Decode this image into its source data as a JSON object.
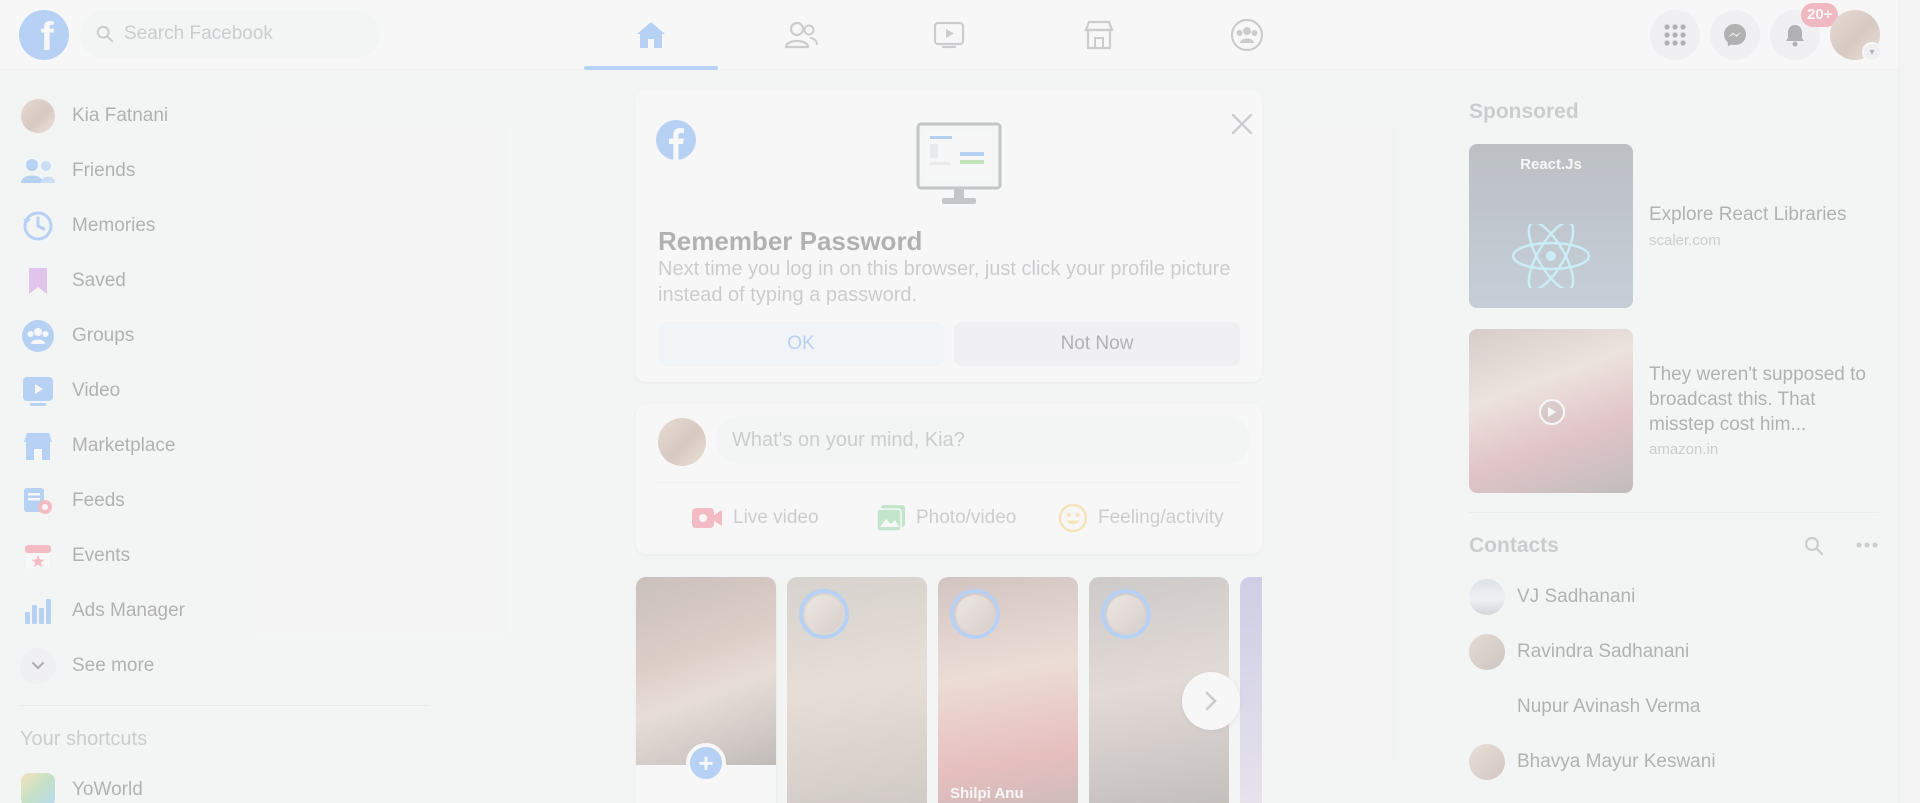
{
  "header": {
    "logo_letter": "f",
    "search_placeholder": "Search Facebook",
    "nav_tabs": [
      "home-icon",
      "friends-icon",
      "watch-icon",
      "marketplace-icon",
      "groups-icon"
    ],
    "notification_badge": "20+"
  },
  "left_nav": {
    "items": [
      {
        "label": "Kia Fatnani",
        "icon": "profile-avatar"
      },
      {
        "label": "Friends",
        "icon": "friends-icon"
      },
      {
        "label": "Memories",
        "icon": "memories-icon"
      },
      {
        "label": "Saved",
        "icon": "saved-icon"
      },
      {
        "label": "Groups",
        "icon": "groups-icon"
      },
      {
        "label": "Video",
        "icon": "video-icon"
      },
      {
        "label": "Marketplace",
        "icon": "marketplace-icon"
      },
      {
        "label": "Feeds",
        "icon": "feeds-icon"
      },
      {
        "label": "Events",
        "icon": "events-icon"
      },
      {
        "label": "Ads Manager",
        "icon": "ads-manager-icon"
      },
      {
        "label": "See more",
        "icon": "chevron-down-icon"
      }
    ],
    "shortcuts_title": "Your shortcuts",
    "shortcuts": [
      {
        "label": "YoWorld"
      }
    ]
  },
  "remember_password": {
    "title": "Remember Password",
    "description": "Next time you log in on this browser, just click your profile picture instead of typing a password.",
    "ok_label": "OK",
    "not_now_label": "Not Now"
  },
  "composer": {
    "placeholder": "What's on your mind, Kia?",
    "actions": [
      {
        "label": "Live video",
        "icon": "live-video-icon"
      },
      {
        "label": "Photo/video",
        "icon": "photo-video-icon"
      },
      {
        "label": "Feeling/activity",
        "icon": "feeling-icon"
      }
    ]
  },
  "stories": [
    {
      "name": "",
      "type": "create"
    },
    {
      "name": ""
    },
    {
      "name": "Shilpi Anu"
    },
    {
      "name": ""
    },
    {
      "name": ""
    }
  ],
  "sponsored": {
    "title": "Sponsored",
    "ads": [
      {
        "title": "Explore React Libraries",
        "domain": "scaler.com",
        "image_text": "React.Js"
      },
      {
        "title": "They weren't supposed to broadcast this. That misstep cost him...",
        "domain": "amazon.in"
      }
    ]
  },
  "contacts": {
    "title": "Contacts",
    "items": [
      {
        "name": "VJ Sadhanani"
      },
      {
        "name": "Ravindra Sadhanani"
      },
      {
        "name": "Nupur Avinash Verma"
      },
      {
        "name": "Bhavya Mayur Keswani"
      }
    ]
  },
  "colors": {
    "brand": "#1877f2",
    "background": "#f0f2f5",
    "overlay": "rgba(244,244,244,0.72)",
    "badge": "#e41e3f"
  }
}
